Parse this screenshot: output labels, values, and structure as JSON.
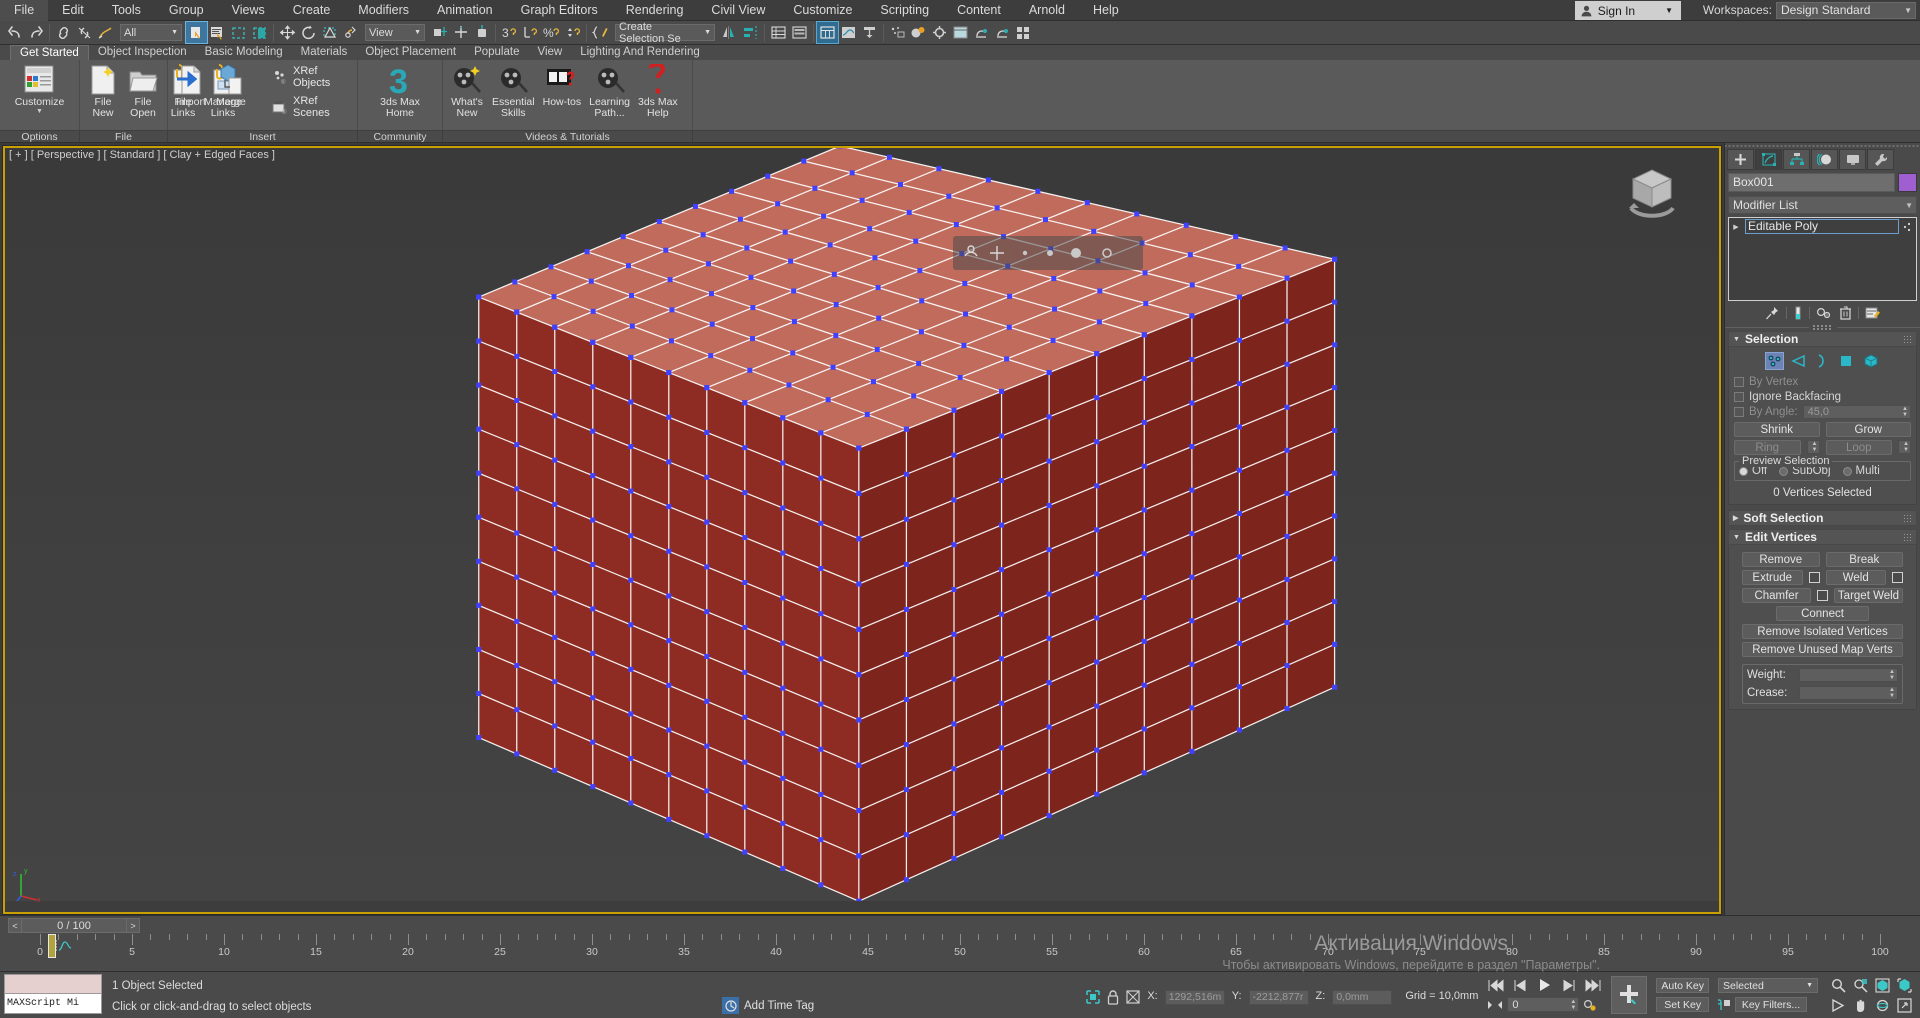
{
  "menu": {
    "items": [
      "File",
      "Edit",
      "Tools",
      "Group",
      "Views",
      "Create",
      "Modifiers",
      "Animation",
      "Graph Editors",
      "Rendering",
      "Civil View",
      "Customize",
      "Scripting",
      "Content",
      "Arnold",
      "Help"
    ],
    "sign_in": "Sign In",
    "workspaces_label": "Workspaces:",
    "workspace_value": "Design Standard"
  },
  "toolbar": {
    "selection_filter": "All",
    "reference_coord": "View",
    "named_selection_sets": "Create Selection Se"
  },
  "ribbon": {
    "tabs": [
      "Get Started",
      "Object Inspection",
      "Basic Modeling",
      "Materials",
      "Object Placement",
      "Populate",
      "View",
      "Lighting And Rendering"
    ],
    "selected_tab": "Get Started",
    "groups": [
      {
        "label": "Options",
        "items": [
          {
            "label": "Customize",
            "icon": "customize-icon",
            "dropdown": true
          }
        ]
      },
      {
        "label": "File",
        "dropdown": true,
        "items": [
          {
            "label": "File\nNew",
            "icon": "file-new-icon"
          },
          {
            "label": "File\nOpen",
            "icon": "file-open-icon"
          },
          {
            "label": "File\nLinks",
            "icon": "file-links-icon",
            "dropdown": true
          },
          {
            "label": "Manage\nLinks",
            "icon": "manage-links-icon"
          }
        ]
      },
      {
        "label": "Insert",
        "items": [
          {
            "label": "Import",
            "icon": "import-icon"
          },
          {
            "label": "Merge",
            "icon": "merge-icon"
          },
          {
            "label": "XRef Objects",
            "icon": "xref-objects-icon",
            "horizontal": true
          },
          {
            "label": "XRef Scenes",
            "icon": "xref-scenes-icon",
            "horizontal": true
          }
        ]
      },
      {
        "label": "Community",
        "dropdown": true,
        "items": [
          {
            "label": "3ds Max\nHome",
            "icon": "max-home-icon"
          }
        ]
      },
      {
        "label": "Videos & Tutorials",
        "items": [
          {
            "label": "What's\nNew",
            "icon": "whats-new-icon"
          },
          {
            "label": "Essential\nSkills",
            "icon": "essential-skills-icon"
          },
          {
            "label": "How-tos",
            "icon": "how-tos-icon"
          },
          {
            "label": "Learning\nPath...",
            "icon": "learning-path-icon"
          },
          {
            "label": "3ds Max\nHelp",
            "icon": "max-help-icon"
          }
        ]
      }
    ]
  },
  "viewport": {
    "label": "[ + ] [ Perspective ] [ Standard ] [ Clay + Edged Faces ]",
    "object_color": "#9e3026",
    "object_top_color": "#c06b5c",
    "edge_color": "#ffffff",
    "vertex_color": "#4040ff",
    "background": "#3d3d3d",
    "active_border_color": "#c8a000",
    "axis_labels": [
      "x",
      "y",
      "z"
    ]
  },
  "command_panel": {
    "tabs": [
      "create-tab",
      "modify-tab",
      "hierarchy-tab",
      "motion-tab",
      "display-tab",
      "utilities-tab"
    ],
    "selected_tab_index": 1,
    "object_name": "Box001",
    "object_color": "#a05fd0",
    "modifier_list_label": "Modifier List",
    "stack": [
      "Editable Poly"
    ],
    "stack_tools": [
      "pin-stack-icon",
      "show-end-result-icon",
      "make-unique-icon",
      "remove-modifier-icon",
      "configure-sets-icon"
    ],
    "selection": {
      "title": "Selection",
      "modes": [
        "vertex-icon",
        "edge-icon",
        "border-icon",
        "polygon-icon",
        "element-icon"
      ],
      "selected_mode_index": 0,
      "by_vertex": "By Vertex",
      "ignore_backfacing": "Ignore Backfacing",
      "by_angle": "By Angle:",
      "by_angle_value": "45,0",
      "shrink": "Shrink",
      "grow": "Grow",
      "ring": "Ring",
      "loop": "Loop",
      "preview_selection": "Preview Selection",
      "preview_options": [
        "Off",
        "SubObj",
        "Multi"
      ],
      "preview_selected": "Off",
      "status": "0 Vertices Selected"
    },
    "soft_selection": {
      "title": "Soft Selection"
    },
    "edit_vertices": {
      "title": "Edit Vertices",
      "buttons": [
        [
          "Remove",
          "Break"
        ],
        [
          "Extrude",
          "Weld"
        ],
        [
          "Chamfer",
          "Target Weld"
        ]
      ],
      "connect": "Connect",
      "remove_isolated": "Remove Isolated Vertices",
      "remove_unused": "Remove Unused Map Verts",
      "weight_label": "Weight:",
      "crease_label": "Crease:"
    }
  },
  "timebar": {
    "frame_display": "0 / 100",
    "prev_label": "<",
    "next_label": ">",
    "ticks": [
      0,
      5,
      10,
      15,
      20,
      25,
      30,
      35,
      40,
      45,
      50,
      55,
      60,
      65,
      70,
      75,
      80,
      85,
      90,
      95,
      100
    ],
    "current_frame": 0
  },
  "statusbar": {
    "maxscript_label": "MAXScript Mi",
    "line1": "1 Object Selected",
    "line2": "Click or click-and-drag to select objects",
    "x_label": "X:",
    "x_value": "1292,516m",
    "y_label": "Y:",
    "y_value": "-2212,877r",
    "z_label": "Z:",
    "z_value": "0,0mm",
    "grid": "Grid = 10,0mm",
    "add_time_tag": "Add Time Tag",
    "auto_key": "Auto Key",
    "set_key": "Set Key",
    "key_mode": "Selected",
    "key_filters": "Key Filters...",
    "key_frame_value": "0"
  },
  "watermark": {
    "title": "Активация Windows",
    "subtitle": "Чтобы активировать Windows, перейдите в раздел \"Параметры\"."
  }
}
